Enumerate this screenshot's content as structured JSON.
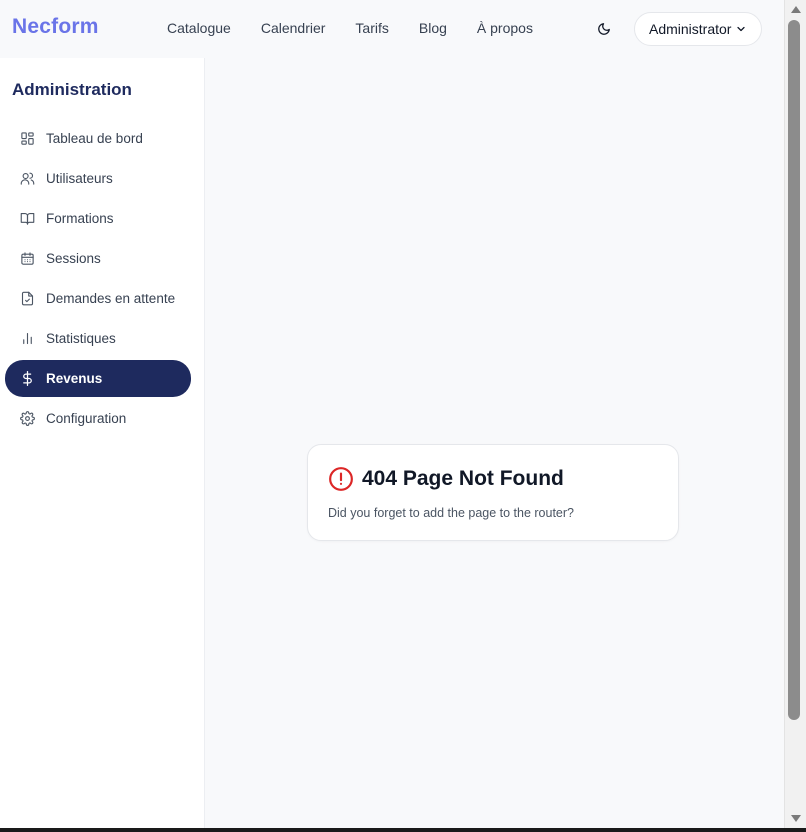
{
  "header": {
    "brand": "Necform",
    "nav": [
      "Catalogue",
      "Calendrier",
      "Tarifs",
      "Blog",
      "À propos"
    ],
    "theme_toggle_icon": "moon-icon",
    "user_menu_label": "Administrator",
    "user_menu_icon": "chevron-down-icon"
  },
  "sidebar": {
    "title": "Administration",
    "items": [
      {
        "label": "Tableau de bord",
        "icon": "dashboard-icon",
        "active": false
      },
      {
        "label": "Utilisateurs",
        "icon": "users-icon",
        "active": false
      },
      {
        "label": "Formations",
        "icon": "book-icon",
        "active": false
      },
      {
        "label": "Sessions",
        "icon": "calendar-icon",
        "active": false
      },
      {
        "label": "Demandes en attente",
        "icon": "file-check-icon",
        "active": false
      },
      {
        "label": "Statistiques",
        "icon": "bar-chart-icon",
        "active": false
      },
      {
        "label": "Revenus",
        "icon": "dollar-icon",
        "active": true
      },
      {
        "label": "Configuration",
        "icon": "gear-icon",
        "active": false
      }
    ]
  },
  "error_card": {
    "title": "404 Page Not Found",
    "message": "Did you forget to add the page to the router?",
    "icon": "alert-circle-icon"
  },
  "colors": {
    "brand": "#6a74e8",
    "sidebar_active_bg": "#1e2a5e",
    "error_icon": "#dc2626"
  }
}
